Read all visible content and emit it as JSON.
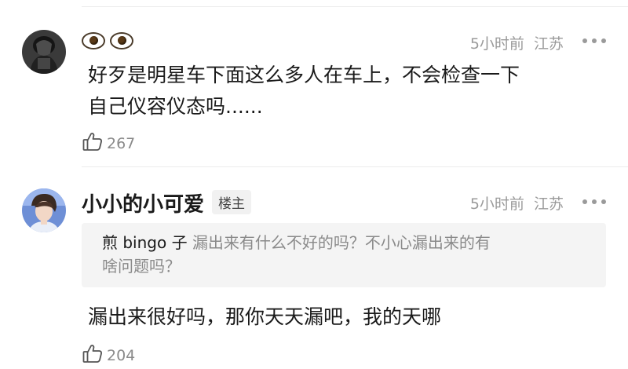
{
  "comments": [
    {
      "author_label": "",
      "author_emoji": "eyes-emoji",
      "time": "5小时前",
      "location": "江苏",
      "text_line1": "好歹是明星车下面这么多人在车上，不会检查一下",
      "text_line2": "自己仪容仪态吗......",
      "likes": "267"
    },
    {
      "author": "小小的小可爱",
      "badge": "楼主",
      "time": "5小时前",
      "location": "江苏",
      "quote_author": "煎 bingo 子",
      "quote_line1": "漏出来有什么不好的吗？不小心漏出来的有",
      "quote_line2": "啥问题吗？",
      "text": "漏出来很好吗，那你天天漏吧，我的天哪",
      "likes": "204"
    }
  ],
  "icons": {
    "more": "more-dots-icon",
    "like": "thumbs-up-icon"
  },
  "colors": {
    "meta_gray": "#9a9a9a",
    "quote_bg": "#f4f4f4",
    "divider": "#ececec"
  }
}
